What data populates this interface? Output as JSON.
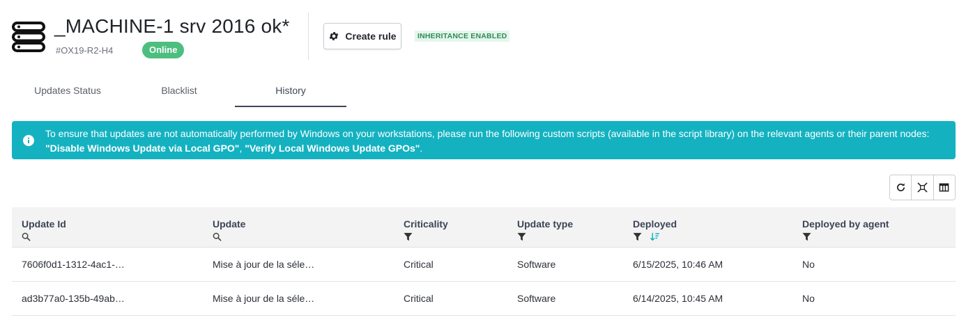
{
  "header": {
    "title": "_MACHINE-1 srv 2016 ok*",
    "machine_id": "#OX19-R2-H4",
    "status": "Online",
    "create_rule_label": "Create rule",
    "inheritance_label": "INHERITANCE ENABLED",
    "colors": {
      "online": "#4cbf7f",
      "inheritance_bg": "#e4f6ec",
      "inheritance_text": "#2f8a55"
    }
  },
  "tabs": [
    {
      "label": "Updates Status",
      "active": false
    },
    {
      "label": "Blacklist",
      "active": false
    },
    {
      "label": "History",
      "active": true
    }
  ],
  "alert": {
    "line1": "To ensure that updates are not automatically performed by Windows on your workstations, please run the following custom scripts (available in the script library) on the relevant agents or their parent nodes:",
    "script1": "\"Disable Windows Update via Local GPO\"",
    "separator": ", ",
    "script2": "\"Verify Local Windows Update GPOs\"",
    "end": ".",
    "color": "#14b2c1"
  },
  "toolbar": {
    "icons": [
      "refresh-icon",
      "fit-columns-icon",
      "columns-icon"
    ]
  },
  "table": {
    "columns": [
      {
        "label": "Update Id",
        "icons": [
          "search-icon"
        ]
      },
      {
        "label": "Update",
        "icons": [
          "search-icon"
        ]
      },
      {
        "label": "Criticality",
        "icons": [
          "filter-icon"
        ]
      },
      {
        "label": "Update type",
        "icons": [
          "filter-icon"
        ]
      },
      {
        "label": "Deployed",
        "icons": [
          "filter-icon",
          "sort-desc-icon"
        ]
      },
      {
        "label": "Deployed by agent",
        "icons": [
          "filter-icon"
        ]
      }
    ],
    "rows": [
      [
        "7606f0d1-1312-4ac1-…",
        "Mise à jour de la séle…",
        "Critical",
        "Software",
        "6/15/2025, 10:46 AM",
        "No"
      ],
      [
        "ad3b77a0-135b-49ab…",
        "Mise à jour de la séle…",
        "Critical",
        "Software",
        "6/14/2025, 10:45 AM",
        "No"
      ]
    ]
  }
}
